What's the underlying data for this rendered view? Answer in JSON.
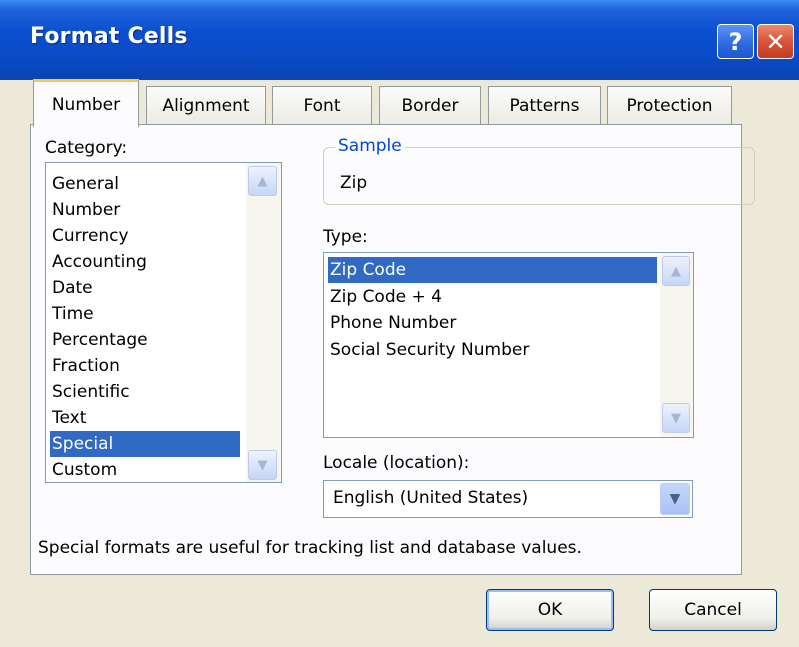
{
  "window": {
    "title": "Format Cells",
    "help_label": "?",
    "close_label": "✕"
  },
  "tabs": [
    {
      "label": "Number",
      "active": true
    },
    {
      "label": "Alignment"
    },
    {
      "label": "Font"
    },
    {
      "label": "Border"
    },
    {
      "label": "Patterns"
    },
    {
      "label": "Protection"
    }
  ],
  "category": {
    "label": "Category:",
    "items": [
      "General",
      "Number",
      "Currency",
      "Accounting",
      "Date",
      "Time",
      "Percentage",
      "Fraction",
      "Scientific",
      "Text",
      "Special",
      "Custom"
    ],
    "selected": "Special"
  },
  "sample": {
    "legend": "Sample",
    "value": "Zip"
  },
  "type": {
    "label": "Type:",
    "items": [
      "Zip Code",
      "Zip Code + 4",
      "Phone Number",
      "Social Security Number"
    ],
    "selected": "Zip Code"
  },
  "locale": {
    "label": "Locale (location):",
    "value": "English (United States)"
  },
  "description": "Special formats are useful for tracking list and database values.",
  "buttons": {
    "ok": "OK",
    "cancel": "Cancel"
  },
  "icons": {
    "scroll_up": "scroll-up-arrow",
    "scroll_down": "scroll-down-arrow",
    "dropdown": "chevron-down"
  }
}
